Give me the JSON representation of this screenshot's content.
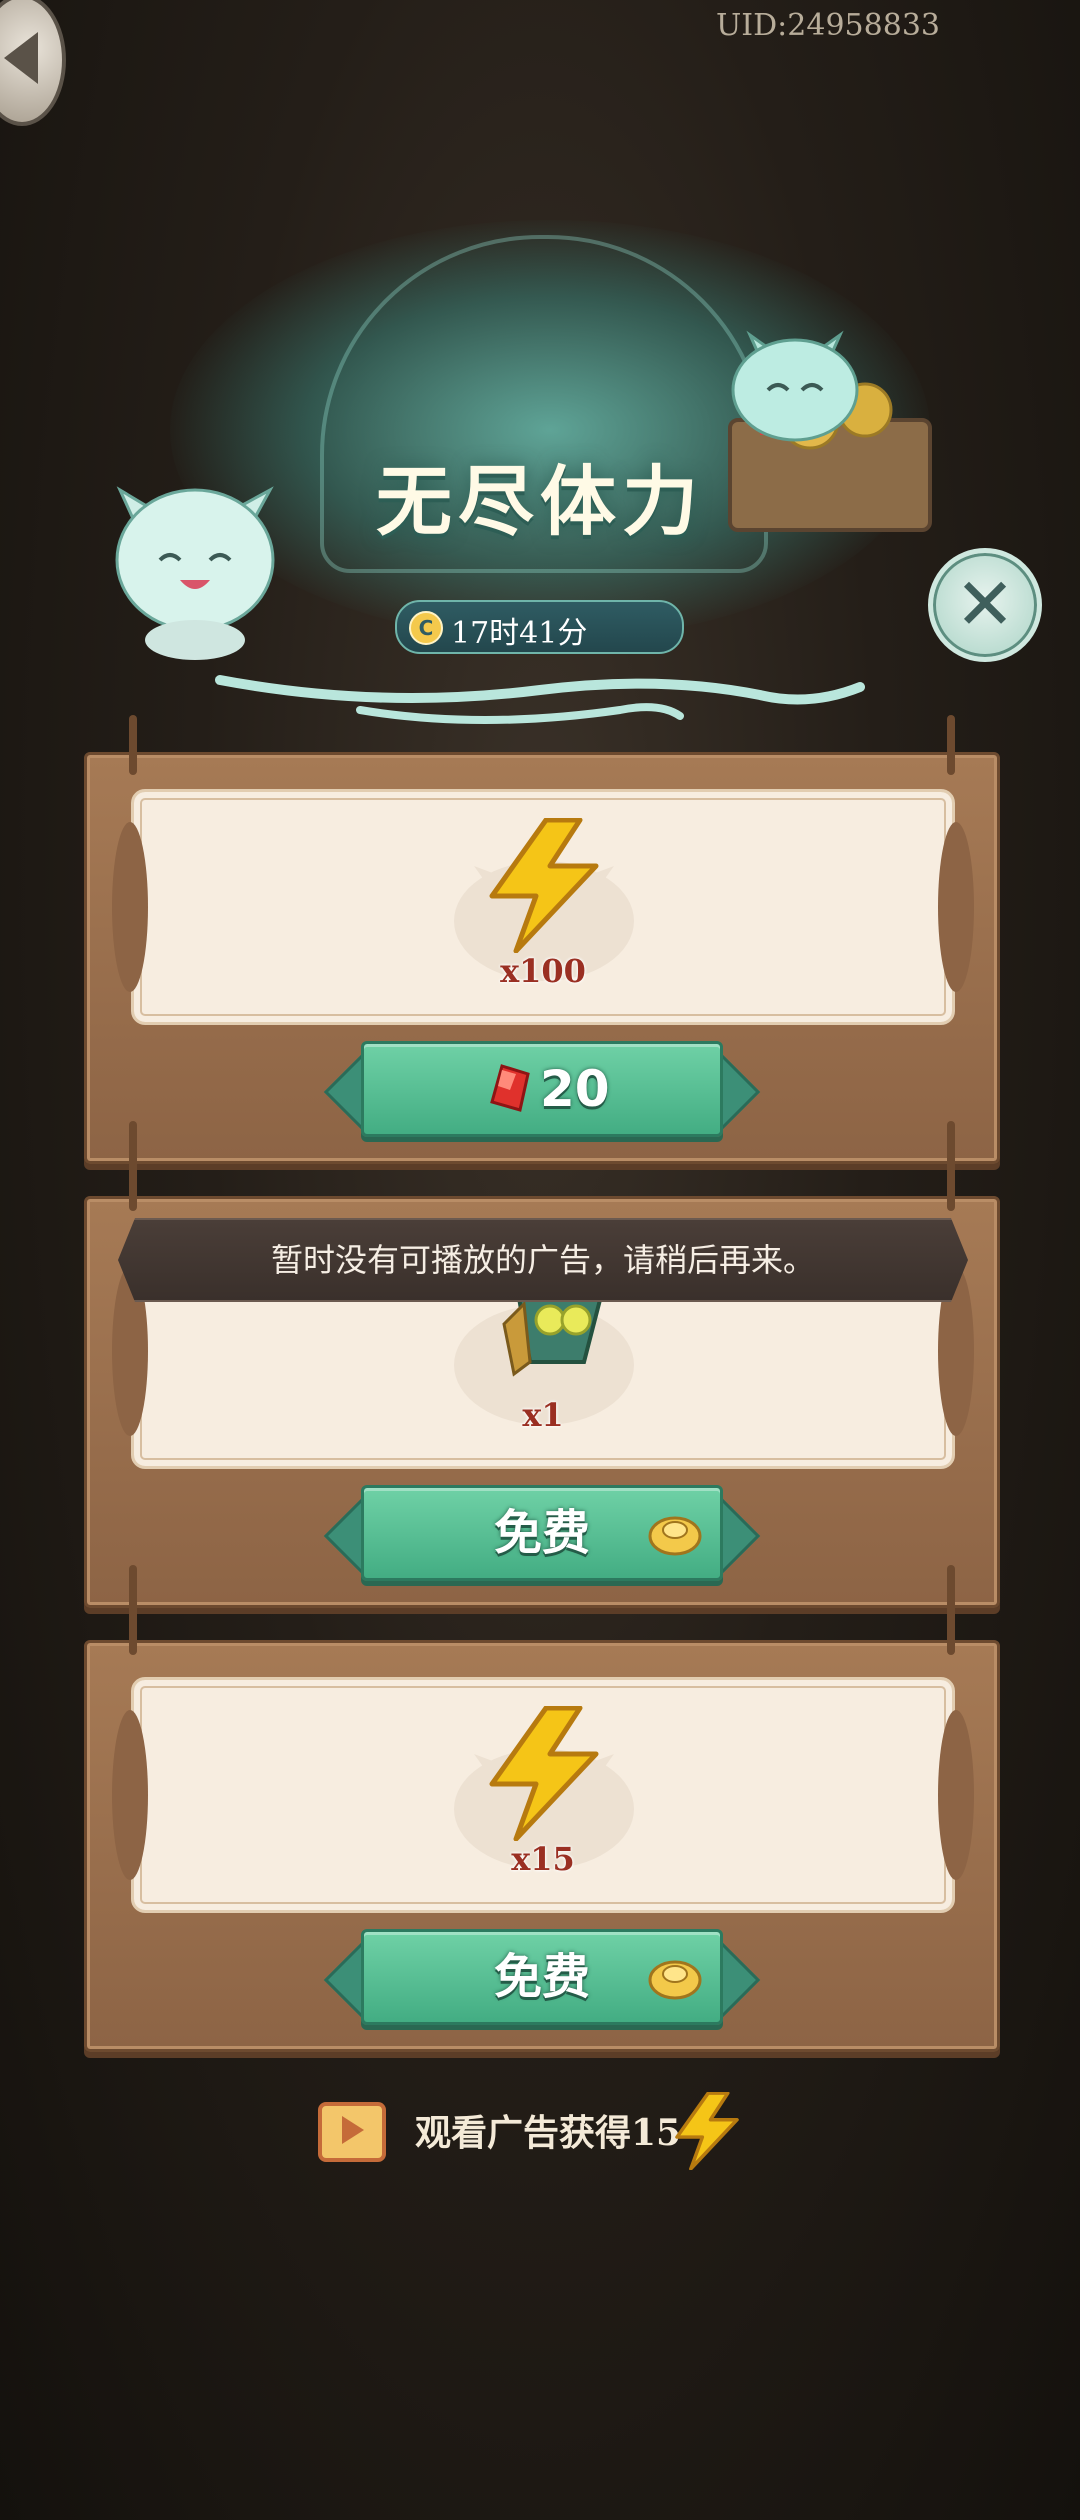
{
  "header": {
    "uid": "UID:24958833",
    "title": "无尽体力",
    "timer_icon": "C",
    "timer": "17时41分"
  },
  "offers": [
    {
      "icon": "lightning-bolt",
      "quantity": "x100",
      "button": {
        "type": "gem",
        "price": "20"
      }
    },
    {
      "icon": "green-ticket",
      "quantity": "x1",
      "button": {
        "type": "free",
        "label": "免费"
      }
    },
    {
      "icon": "lightning-bolt",
      "quantity": "x15",
      "button": {
        "type": "free",
        "label": "免费"
      }
    }
  ],
  "toast": "暂时没有可播放的广告，请稍后再来。",
  "footer": {
    "ad_text": "观看广告获得15",
    "ad_icon": "video-play-icon",
    "reward_icon": "lightning-bolt"
  },
  "colors": {
    "accent_green": "#43ad83",
    "wood": "#8d6445",
    "parchment": "#f7ede0",
    "qty_red": "#9a2f22"
  }
}
